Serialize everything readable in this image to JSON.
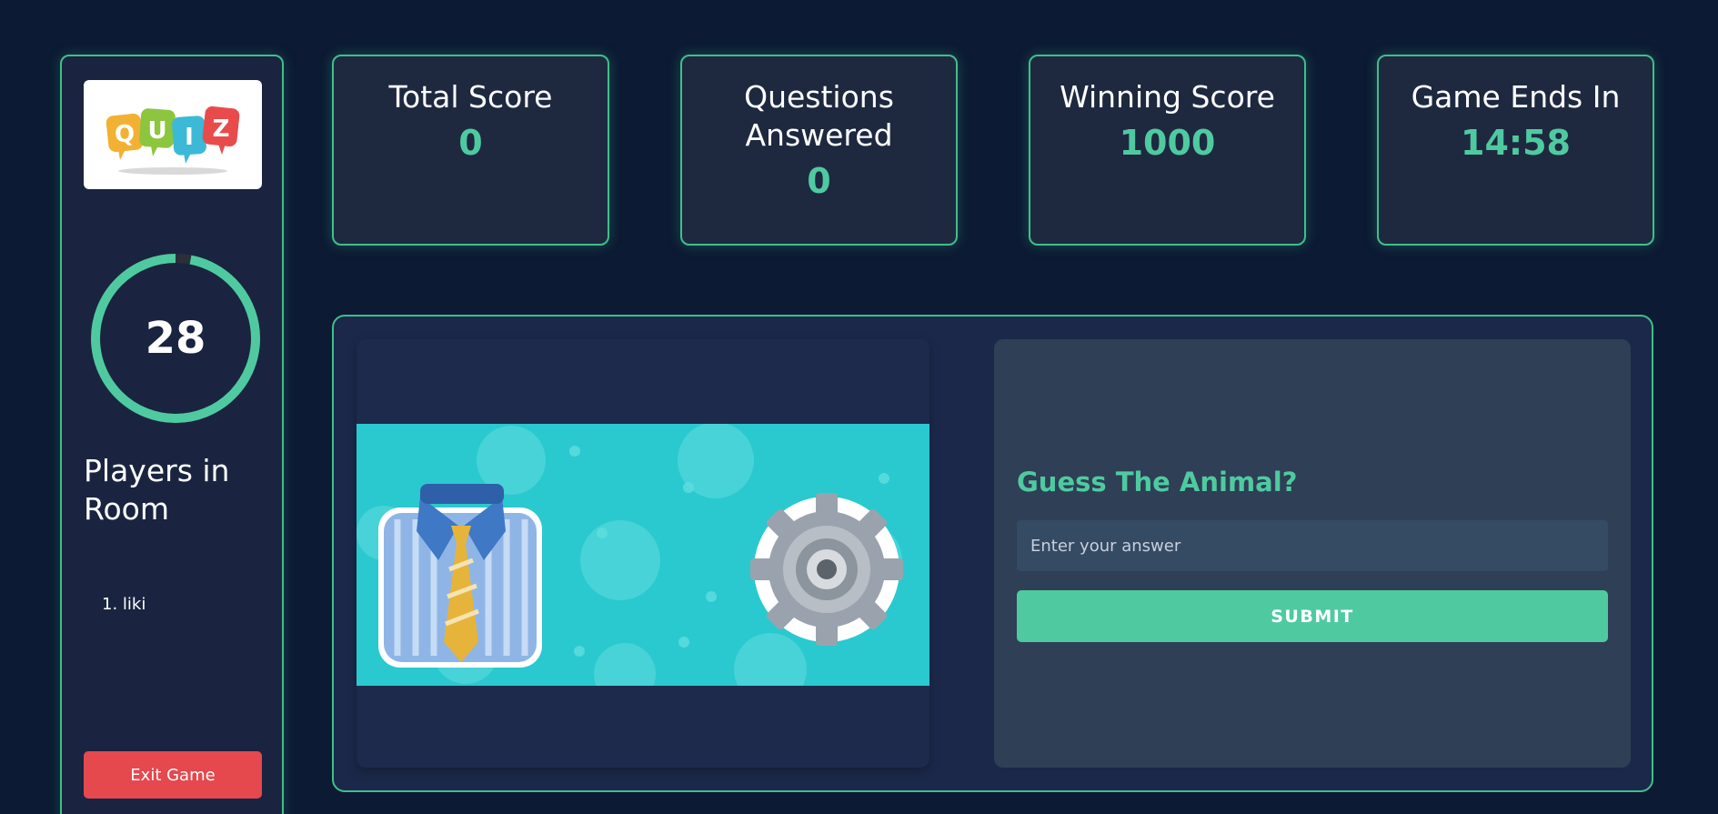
{
  "sidebar": {
    "logo_text": "QUIZ",
    "timer_value": "28",
    "timer_fraction": 0.97,
    "players_title": "Players in Room",
    "players": [
      "1. liki"
    ],
    "exit_label": "Exit Game"
  },
  "stats": [
    {
      "label": "Total Score",
      "value": "0"
    },
    {
      "label": "Questions Answered",
      "value": "0"
    },
    {
      "label": "Winning Score",
      "value": "1000"
    },
    {
      "label": "Game Ends In",
      "value": "14:58"
    }
  ],
  "game": {
    "emoji_icons": [
      "shirt-tie-icon",
      "gear-icon"
    ],
    "question": "Guess The Animal?",
    "input_placeholder": "Enter your answer",
    "input_value": "",
    "submit_label": "SUBMIT"
  },
  "colors": {
    "background": "#0c1a33",
    "accent": "#4fcaa0",
    "border": "#3fbf8a",
    "exit": "#e5484d"
  }
}
